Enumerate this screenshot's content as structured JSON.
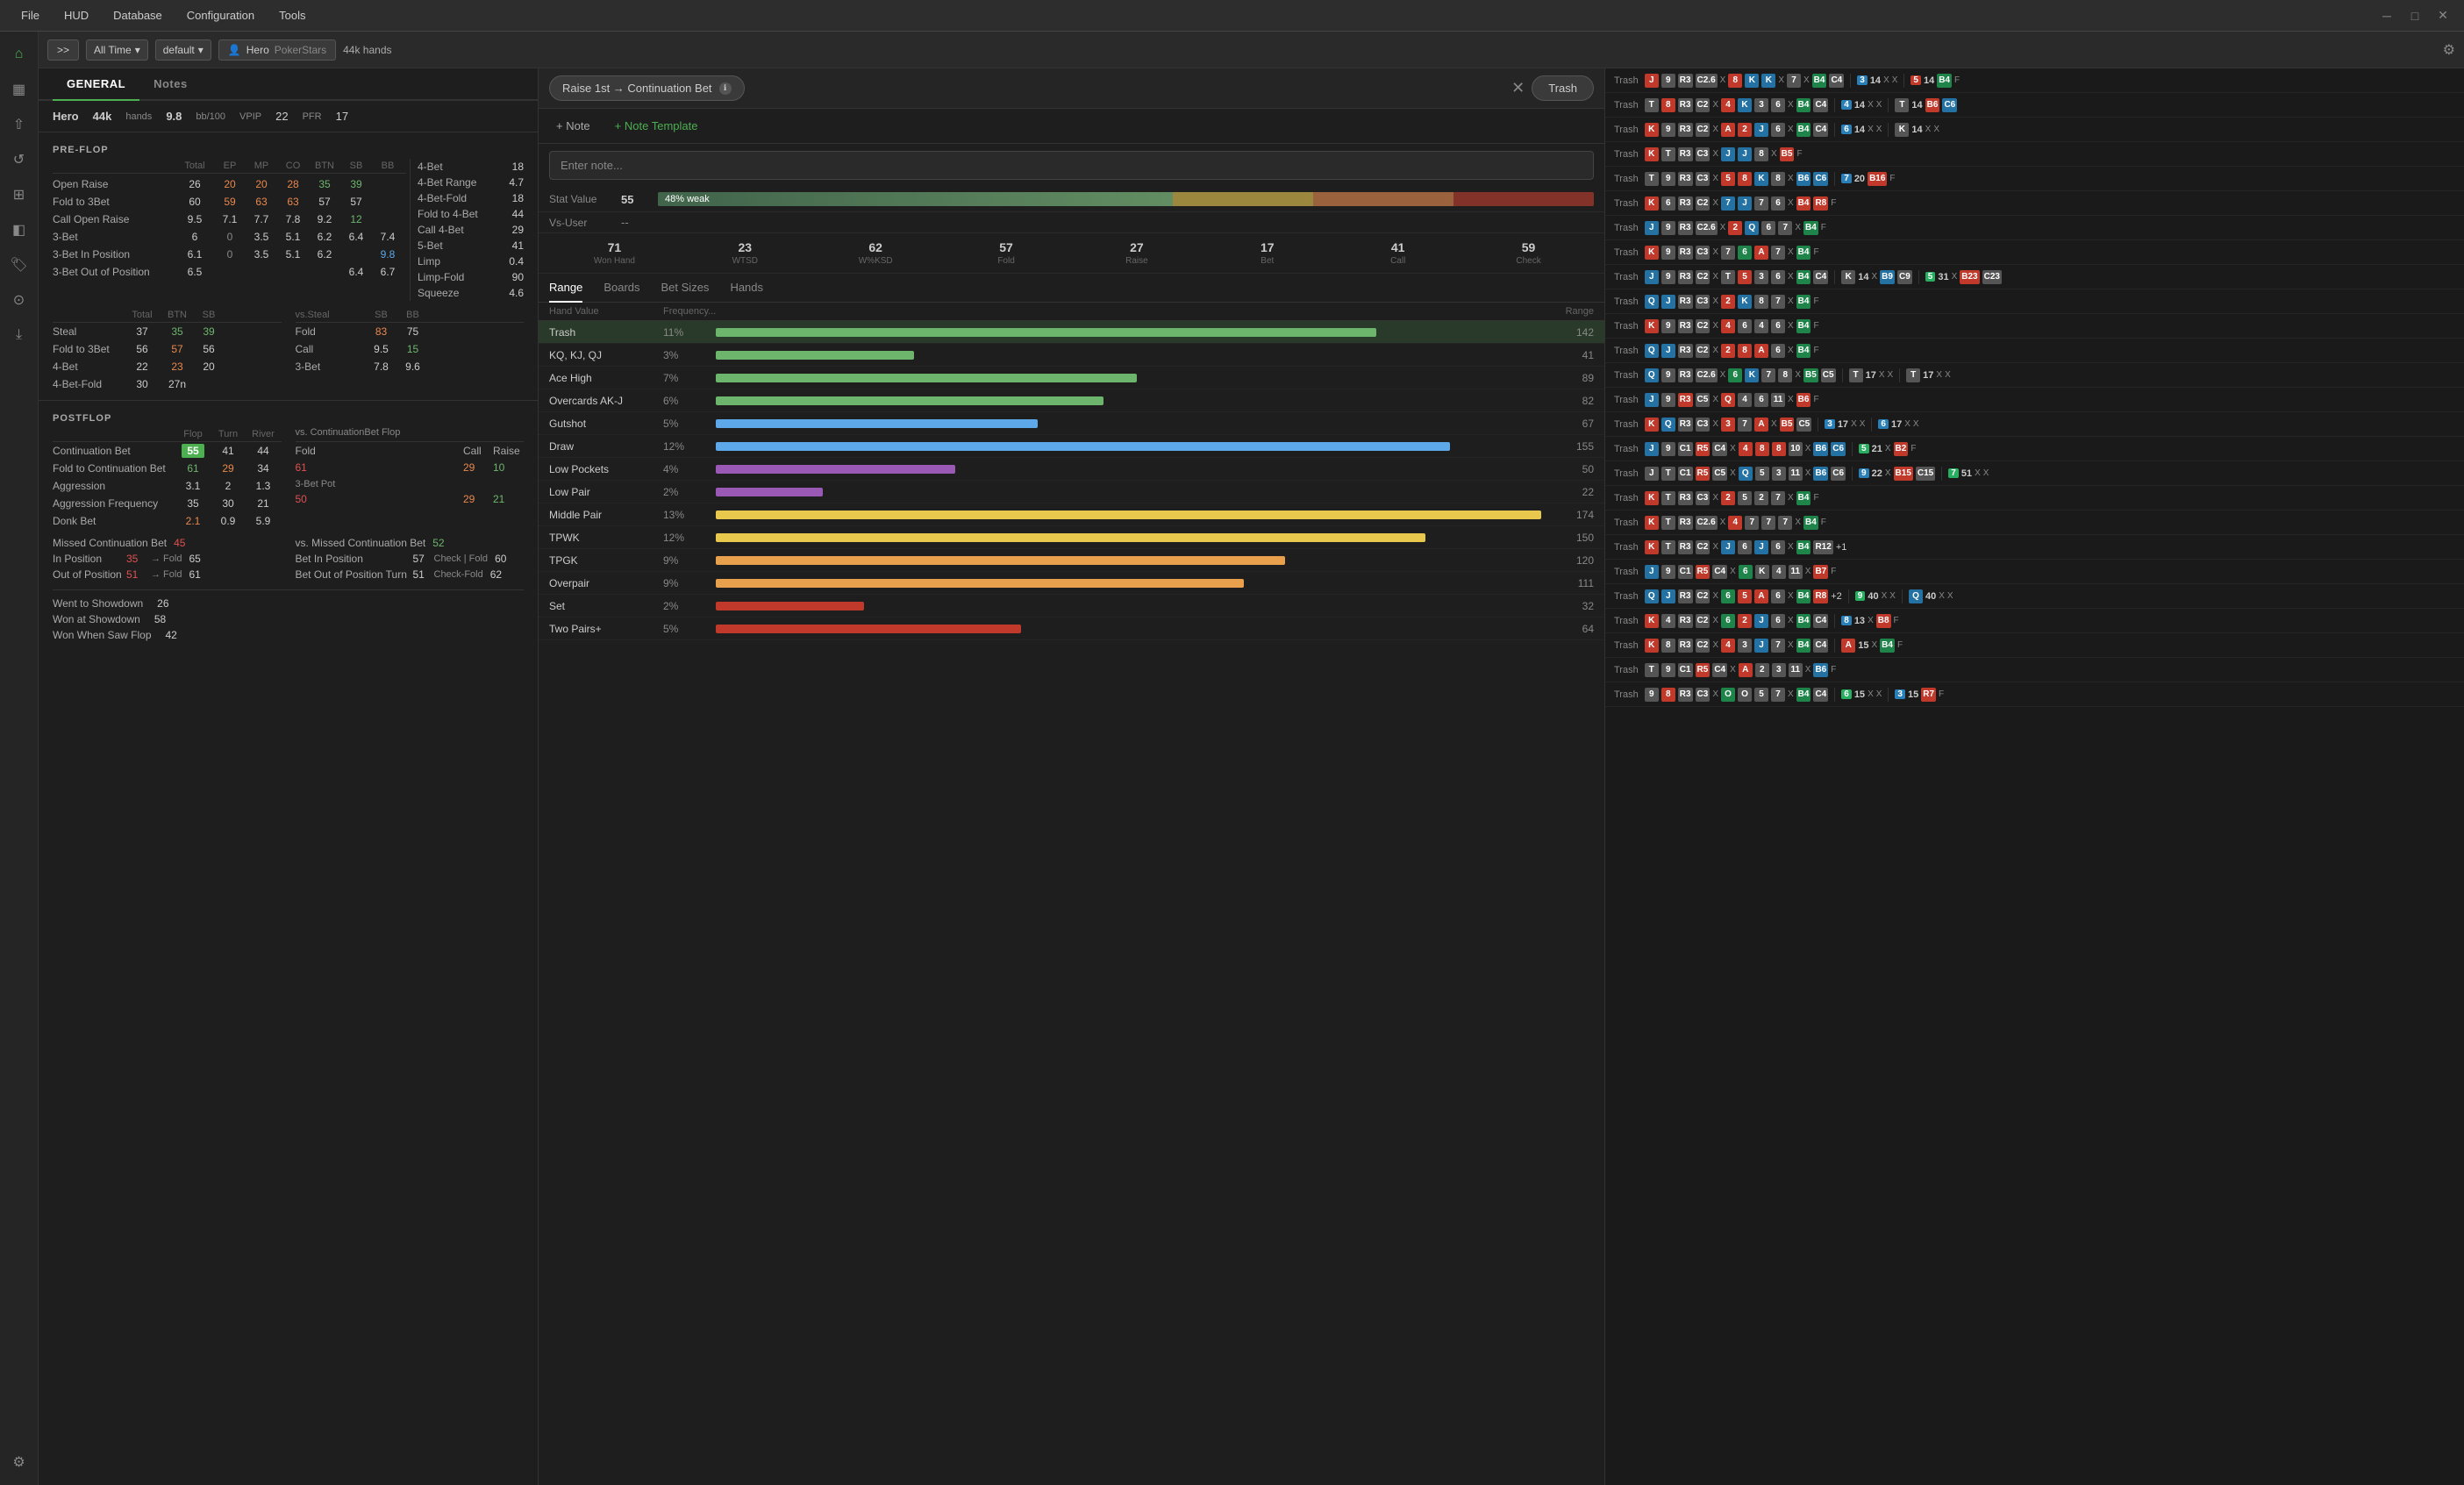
{
  "menuBar": {
    "items": [
      "File",
      "HUD",
      "Database",
      "Configuration",
      "Tools"
    ]
  },
  "toolbar": {
    "expandBtn": ">>",
    "timeRange": "All Time",
    "profile": "default",
    "playerIcon": "👤",
    "playerName": "Hero",
    "playerSite": "PokerStars",
    "handsCount": "44k hands",
    "gearIcon": "⚙"
  },
  "tabs": {
    "general": "GENERAL",
    "notes": "Notes"
  },
  "hero": {
    "name": "Hero",
    "hands": "44k",
    "handsLabel": "hands",
    "bb100": "9.8",
    "bb100Label": "bb/100",
    "vpip": "VPIP",
    "vpipVal": "22",
    "pfr": "PFR",
    "pfrVal": "17"
  },
  "preflop": {
    "header": "PRE-FLOP",
    "cols": [
      "Total",
      "EP",
      "MP",
      "CO",
      "BTN",
      "SB",
      "BB"
    ],
    "rows": [
      {
        "name": "Open Raise",
        "vals": [
          "26",
          "20",
          "20",
          "28",
          "35",
          "39",
          ""
        ],
        "colors": [
          "normal",
          "orange",
          "orange",
          "orange",
          "green",
          "green",
          ""
        ]
      },
      {
        "name": "Fold to 3Bet",
        "vals": [
          "60",
          "59",
          "63",
          "63",
          "57",
          "57",
          ""
        ],
        "colors": [
          "normal",
          "orange",
          "orange",
          "orange",
          "normal",
          "normal",
          ""
        ]
      },
      {
        "name": "Call Open Raise",
        "vals": [
          "9.5",
          "7.1",
          "7.7",
          "7.8",
          "9.2",
          "12",
          ""
        ],
        "colors": [
          "normal",
          "normal",
          "normal",
          "normal",
          "normal",
          "green",
          ""
        ]
      },
      {
        "name": "3-Bet",
        "vals": [
          "6",
          "0",
          "3.5",
          "5.1",
          "6.2",
          "6.4",
          "7.4"
        ],
        "colors": [
          "normal",
          "gray",
          "normal",
          "normal",
          "normal",
          "normal",
          "normal"
        ]
      },
      {
        "name": "3-Bet In Position",
        "vals": [
          "6.1",
          "0",
          "3.5",
          "5.1",
          "6.2",
          "",
          "9.8"
        ],
        "colors": [
          "normal",
          "gray",
          "normal",
          "normal",
          "normal",
          "",
          "blue"
        ]
      },
      {
        "name": "3-Bet Out of Position",
        "vals": [
          "6.5",
          "",
          "",
          "",
          "",
          "6.4",
          "6.7"
        ],
        "colors": [
          "normal",
          "",
          "",
          "",
          "",
          "normal",
          "normal"
        ]
      }
    ],
    "rightStats": {
      "fourBet": {
        "label": "4-Bet",
        "val": "18"
      },
      "fourBetRange": {
        "label": "4-Bet Range",
        "val": "4.7"
      },
      "fourBetFold": {
        "label": "4-Bet-Fold",
        "val": "18"
      },
      "foldTo4Bet": {
        "label": "Fold to 4-Bet",
        "val": "44"
      },
      "call4Bet": {
        "label": "Call 4-Bet",
        "val": "29"
      },
      "fiveBet": {
        "label": "5-Bet",
        "val": "41"
      },
      "limp": {
        "label": "Limp",
        "val": "0.4"
      },
      "limpFold": {
        "label": "Limp-Fold",
        "val": "90"
      },
      "squeeze": {
        "label": "Squeeze",
        "val": "4.6"
      }
    }
  },
  "steal": {
    "cols": [
      "Total",
      "BTN",
      "SB",
      "vs.Steal",
      "SB",
      "BB"
    ],
    "rows": [
      {
        "name": "Steal",
        "vals": [
          "37",
          "35",
          "39"
        ],
        "vsVals": [
          "Fold",
          "83",
          "75"
        ]
      },
      {
        "name": "Fold to 3Bet",
        "vals": [
          "56",
          "57",
          "56"
        ],
        "vsVals": [
          "Call",
          "9.5",
          "15"
        ]
      },
      {
        "name": "4-Bet",
        "vals": [
          "22",
          "23",
          "20"
        ],
        "vsVals": [
          "3-Bet",
          "7.8",
          "9.6"
        ]
      },
      {
        "name": "4-Bet-Fold",
        "vals": [
          "30",
          "27n",
          ""
        ],
        "vsVals": [
          "",
          "",
          ""
        ]
      }
    ]
  },
  "postflop": {
    "header": "POSTFLOP",
    "cols": [
      "Flop",
      "Turn",
      "River"
    ],
    "rows": [
      {
        "name": "Continuation Bet",
        "flop": "55",
        "turn": "41",
        "river": "44",
        "isCbet": true
      },
      {
        "name": "Fold to Continuation Bet",
        "flop": "61",
        "turn": "29",
        "river": "34"
      },
      {
        "name": "Aggression",
        "flop": "3.1",
        "turn": "2",
        "river": "1.3"
      },
      {
        "name": "Aggression Frequency",
        "flop": "35",
        "turn": "30",
        "river": "21"
      },
      {
        "name": "Donk Bet",
        "flop": "2.1",
        "turn": "0.9",
        "river": "5.9"
      }
    ],
    "vsCbet": {
      "label": "vs. ContinuationBet Flop",
      "fold": "61",
      "call": "29",
      "raise": "10",
      "raisedPot": "3-Bet Pot",
      "raisedFold": "50",
      "raisedCall": "29",
      "raisedRaise": "21"
    },
    "missedCbet": {
      "label": "Missed Continuation Bet",
      "val": "45"
    },
    "vsMissedCbet": {
      "label": "vs. Missed Continuation Bet",
      "val": "52"
    },
    "inPosition": {
      "label": "In Position",
      "val": "35",
      "fold": "→ Fold",
      "foldVal": "65",
      "check": "Bet In Position",
      "checkVal": "57",
      "checkFold": "Check | Fold",
      "checkFoldVal": "60"
    },
    "outPosition": {
      "label": "Out of Position",
      "val": "51",
      "fold": "→ Fold",
      "foldVal": "61",
      "check": "Bet Out of Position Turn",
      "checkVal": "51",
      "checkFold": "Check-Fold",
      "checkFoldVal": "62"
    }
  },
  "went": {
    "wentToShowdown": {
      "label": "Went to Showdown",
      "val": "26"
    },
    "wonAtShowdown": {
      "label": "Won at Showdown",
      "val": "58"
    },
    "wonWhenSawFlop": {
      "label": "Won When Saw Flop",
      "val": "42"
    }
  },
  "notePanel": {
    "title": "Raise 1st → Continuation Bet",
    "infoIcon": "ℹ",
    "trashBtn": "Trash",
    "addNote": "+ Note",
    "addTemplate": "+ Note Template",
    "notePlaceholder": "Enter note...",
    "statValueLabel": "Stat Value",
    "statValueNum": "55",
    "statBarLabel": "48% weak",
    "vsUserLabel": "Vs-User",
    "vsUserVal": "--"
  },
  "handStats": {
    "wonHand": {
      "val": "71",
      "label": "Won Hand"
    },
    "wtsd": {
      "val": "23",
      "label": "WTSD"
    },
    "wksd": {
      "val": "62",
      "label": "W%KSD"
    },
    "fold": {
      "val": "57",
      "label": "Fold"
    },
    "raise": {
      "val": "27",
      "label": "Raise"
    },
    "bet": {
      "val": "17",
      "label": "Bet"
    },
    "call": {
      "val": "41",
      "label": "Call"
    },
    "check": {
      "val": "59",
      "label": "Check"
    }
  },
  "navTabs": [
    "Range",
    "Boards",
    "Bet Sizes",
    "Hands"
  ],
  "rangeHeader": {
    "handValue": "Hand Value",
    "frequency": "Frequency...",
    "range": "Range"
  },
  "rangeRows": [
    {
      "name": "Trash",
      "pct": "11%",
      "barColor": "#6db56d",
      "barWidth": 80,
      "count": "142",
      "selected": true
    },
    {
      "name": "KQ, KJ, QJ",
      "pct": "3%",
      "barColor": "#6db56d",
      "barWidth": 23,
      "count": "41"
    },
    {
      "name": "Ace High",
      "pct": "7%",
      "barColor": "#6db56d",
      "barWidth": 52,
      "count": "89"
    },
    {
      "name": "Overcards AK-J",
      "pct": "6%",
      "barColor": "#6db56d",
      "barWidth": 48,
      "count": "82"
    },
    {
      "name": "Gutshot",
      "pct": "5%",
      "barColor": "#5da8e8",
      "barWidth": 40,
      "count": "67"
    },
    {
      "name": "Draw",
      "pct": "12%",
      "barColor": "#5da8e8",
      "barWidth": 90,
      "count": "155"
    },
    {
      "name": "Low Pockets",
      "pct": "4%",
      "barColor": "#9b59b6",
      "barWidth": 30,
      "count": "50"
    },
    {
      "name": "Low Pair",
      "pct": "2%",
      "barColor": "#9b59b6",
      "barWidth": 13,
      "count": "22"
    },
    {
      "name": "Middle Pair",
      "pct": "13%",
      "barColor": "#e8c84d",
      "barWidth": 100,
      "count": "174"
    },
    {
      "name": "TPWK",
      "pct": "12%",
      "barColor": "#e8c84d",
      "barWidth": 88,
      "count": "150"
    },
    {
      "name": "TPGK",
      "pct": "9%",
      "barColor": "#e8a04d",
      "barWidth": 70,
      "count": "120"
    },
    {
      "name": "Overpair",
      "pct": "9%",
      "barColor": "#e8a04d",
      "barWidth": 65,
      "count": "111"
    },
    {
      "name": "Set",
      "pct": "2%",
      "barColor": "#c0392b",
      "barWidth": 19,
      "count": "32"
    },
    {
      "name": "Two Pairs+",
      "pct": "5%",
      "barColor": "#c0392b",
      "barWidth": 38,
      "count": "64"
    }
  ],
  "handsPanel": {
    "rows": [
      {
        "tag": "Trash",
        "cards": [
          {
            "v": "J",
            "s": "9",
            "c": "red"
          },
          {
            "v": "R3",
            "c": "dark"
          },
          {
            "v": "C2.6",
            "c": "dark"
          },
          {
            "x": true
          },
          {
            "v": "8",
            "c": "red"
          },
          {
            "v": "K",
            "c": "blue"
          },
          {
            "v": "K",
            "c": "blue"
          },
          {
            "x": true
          },
          {
            "v": "7",
            "c": "dark"
          },
          {
            "v": "X",
            "c": "gray"
          },
          {
            "v": "B4",
            "c": "green"
          },
          {
            "v": "C4",
            "c": "dark"
          },
          {
            "sep": true
          },
          {
            "n": "3",
            "c": "blue"
          },
          {
            "v": "14",
            "c": "dark"
          },
          {
            "v": "X",
            "c": "gray"
          },
          {
            "v": "X",
            "c": "gray"
          },
          {
            "sep2": true
          },
          {
            "n": "5",
            "c": "red"
          },
          {
            "v": "14",
            "c": "dark"
          },
          {
            "v": "B4",
            "c": "green"
          },
          {
            "v": "F",
            "c": "dark"
          }
        ]
      },
      {
        "tag": "Trash",
        "group2": true
      },
      {
        "tag": "Trash",
        "group3": true
      }
    ]
  },
  "windowControls": {
    "minimize": "─",
    "maximize": "□",
    "close": "✕"
  }
}
